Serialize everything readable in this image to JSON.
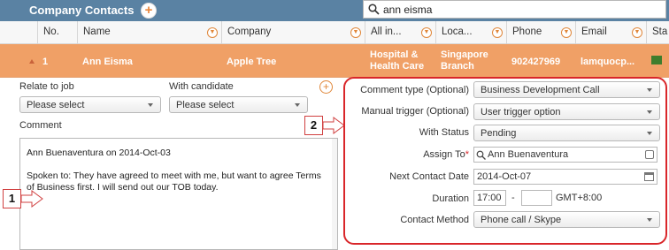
{
  "header": {
    "title": "Company Contacts",
    "add_icon_glyph": "+",
    "search_value": "ann eisma"
  },
  "table": {
    "columns": [
      "No.",
      "Name",
      "Company",
      "All in...",
      "Loca...",
      "Phone",
      "Email",
      "Sta"
    ],
    "row": {
      "no": "1",
      "name": "Ann Eisma",
      "company": "Apple Tree",
      "all_in": "Hospital & Health Care",
      "location": "Singapore Branch",
      "phone": "902427969",
      "email": "lamquocp..."
    }
  },
  "left_panel": {
    "relate_label": "Relate to job",
    "candidate_label": "With candidate",
    "relate_select": "Please select",
    "candidate_select": "Please select",
    "comment_label": "Comment",
    "comment_line1": "Ann Buenaventura on 2014-Oct-03",
    "comment_body": "Spoken to: They have agreed to meet with me, but want to agree Terms of Business first. I will send out our TOB today."
  },
  "right_panel": {
    "comment_type_label": "Comment type (Optional)",
    "comment_type_value": "Business Development Call",
    "manual_trigger_label": "Manual trigger (Optional)",
    "manual_trigger_value": "User trigger option",
    "with_status_label": "With Status",
    "with_status_value": "Pending",
    "assign_to_label": "Assign To",
    "assign_to_required": "*",
    "assign_to_value": "Ann Buenaventura",
    "next_contact_label": "Next Contact Date",
    "next_contact_value": "2014-Oct-07",
    "duration_label": "Duration",
    "duration_hours": "17:00",
    "duration_separator": "-",
    "duration_to": "",
    "duration_tz": "GMT+8:00",
    "contact_method_label": "Contact Method",
    "contact_method_value": "Phone call / Skype"
  },
  "callouts": {
    "one": "1",
    "two": "2"
  },
  "colors": {
    "header_bar": "#5a82a3",
    "selected_row": "#f0a066",
    "accent_orange": "#e0873a",
    "callout_red": "#d9262a"
  },
  "icons": {
    "add": "plus-circle-icon",
    "search": "search-icon",
    "filter": "filter-icon",
    "dropdown": "chevron-down-icon",
    "calendar": "calendar-icon",
    "contact_card": "contact-card-icon"
  }
}
